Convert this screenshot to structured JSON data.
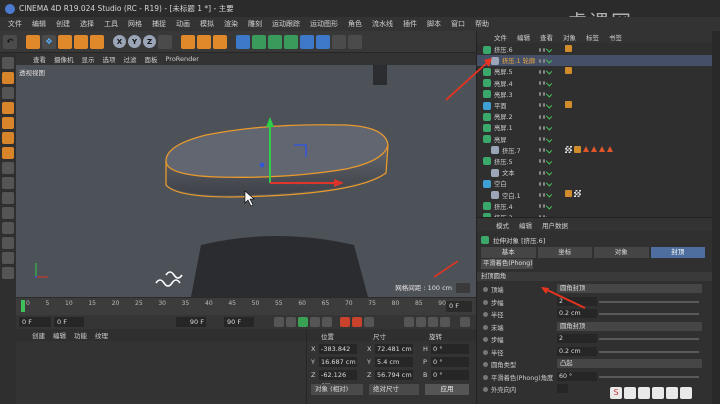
{
  "window": {
    "title": "CINEMA 4D R19.024 Studio (RC - R19) - [未标题 1 *] - 主要"
  },
  "watermark": "虎课网",
  "menu": [
    "文件",
    "编辑",
    "创建",
    "选择",
    "工具",
    "网格",
    "捕捉",
    "动画",
    "模拟",
    "渲染",
    "雕刻",
    "运动跟踪",
    "运动图形",
    "角色",
    "流水线",
    "插件",
    "脚本",
    "窗口",
    "帮助"
  ],
  "toolbar": {
    "axes": [
      "X",
      "Y",
      "Z"
    ]
  },
  "viewport": {
    "menu": [
      "查看",
      "摄像机",
      "显示",
      "选项",
      "过滤",
      "面板",
      "ProRender"
    ],
    "label": "透视视图",
    "grid_info": "网格间距 : 100 cm"
  },
  "timeline": {
    "ticks": [
      "0",
      "5",
      "10",
      "15",
      "20",
      "25",
      "30",
      "35",
      "40",
      "45",
      "50",
      "55",
      "60",
      "65",
      "70",
      "75",
      "80",
      "85",
      "90"
    ],
    "end_frame": "0 F"
  },
  "transport": {
    "current": "0 F",
    "start": "0 F",
    "end": "90 F",
    "range_end": "90 F"
  },
  "material": {
    "menu": [
      "创建",
      "编辑",
      "功能",
      "纹理"
    ]
  },
  "coords": {
    "headers": [
      "位置",
      "尺寸",
      "旋转"
    ],
    "rows": [
      {
        "pos_label": "X",
        "pos": "-383.842 cm",
        "size_label": "X",
        "size": "72.481 cm",
        "rot_label": "H",
        "rot": "0 °"
      },
      {
        "pos_label": "Y",
        "pos": "16.687 cm",
        "size_label": "Y",
        "size": "5.4 cm",
        "rot_label": "P",
        "rot": "0 °"
      },
      {
        "pos_label": "Z",
        "pos": "-62.126 cm",
        "size_label": "Z",
        "size": "56.794 cm",
        "rot_label": "B",
        "rot": "0 °"
      }
    ],
    "mode": "对象 (相对)",
    "size_mode": "绝对尺寸",
    "apply": "应用"
  },
  "objects": {
    "menu": [
      "文件",
      "编辑",
      "查看",
      "对象",
      "标签",
      "书签"
    ],
    "list": [
      {
        "name": "挤压.6",
        "icon": "extrude",
        "selected": false,
        "tags": "dot"
      },
      {
        "name": "挤压.1 轮廓",
        "icon": "spline",
        "selected": true,
        "tags": ""
      },
      {
        "name": "亮屏.5",
        "icon": "extrude",
        "selected": false,
        "tags": "dot"
      },
      {
        "name": "亮屏.4",
        "icon": "extrude",
        "selected": false,
        "tags": ""
      },
      {
        "name": "亮屏.3",
        "icon": "extrude",
        "selected": false,
        "tags": ""
      },
      {
        "name": "平面",
        "icon": "nurb",
        "selected": false,
        "tags": "dot"
      },
      {
        "name": "亮屏.2",
        "icon": "extrude",
        "selected": false,
        "tags": ""
      },
      {
        "name": "亮屏.1",
        "icon": "extrude",
        "selected": false,
        "tags": ""
      },
      {
        "name": "亮屏",
        "icon": "extrude",
        "selected": false,
        "tags": ""
      },
      {
        "name": "挤压.7",
        "icon": "spline",
        "selected": false,
        "tags": "tri"
      },
      {
        "name": "挤压.5",
        "icon": "extrude",
        "selected": false,
        "tags": ""
      },
      {
        "name": "文本",
        "icon": "spline",
        "selected": false,
        "tags": ""
      },
      {
        "name": "空白",
        "icon": "nurb",
        "selected": false,
        "tags": ""
      },
      {
        "name": "空白.1",
        "icon": "spline",
        "selected": false,
        "tags": "chk"
      },
      {
        "name": "挤压.4",
        "icon": "extrude",
        "selected": false,
        "tags": ""
      },
      {
        "name": "挤压.3",
        "icon": "extrude",
        "selected": false,
        "tags": ""
      }
    ]
  },
  "attributes": {
    "menu": [
      "模式",
      "编辑",
      "用户数据"
    ],
    "header": "拉伸对象 [挤压.6]",
    "tabs": [
      "基本",
      "坐标",
      "对象",
      "封顶"
    ],
    "active_tab": "封顶",
    "phong": "平滑着色(Phong)",
    "section": "封顶圆角",
    "rows": [
      {
        "label": "顶端",
        "type": "drop",
        "value": "圆角封顶"
      },
      {
        "label": "步幅",
        "type": "num",
        "value": "2"
      },
      {
        "label": "半径",
        "type": "num",
        "value": "0.2 cm"
      },
      {
        "label": "末端",
        "type": "drop",
        "value": "圆角封顶"
      },
      {
        "label": "步幅",
        "type": "num",
        "value": "2"
      },
      {
        "label": "半径",
        "type": "num",
        "value": "0.2 cm"
      },
      {
        "label": "圆角类型",
        "type": "drop",
        "value": "凸起"
      },
      {
        "label": "平滑着色(Phong)角度",
        "type": "num",
        "value": "60 °"
      },
      {
        "label": "外壳向内",
        "type": "check",
        "value": ""
      }
    ]
  },
  "colors": {
    "accent_orange": "#e0892b",
    "selection_outline": "#e89a2e",
    "axis_y": "#2fcf4a",
    "axis_x": "#e0342a",
    "axis_z": "#3557d6",
    "annotation_arrow": "#e8341f"
  }
}
